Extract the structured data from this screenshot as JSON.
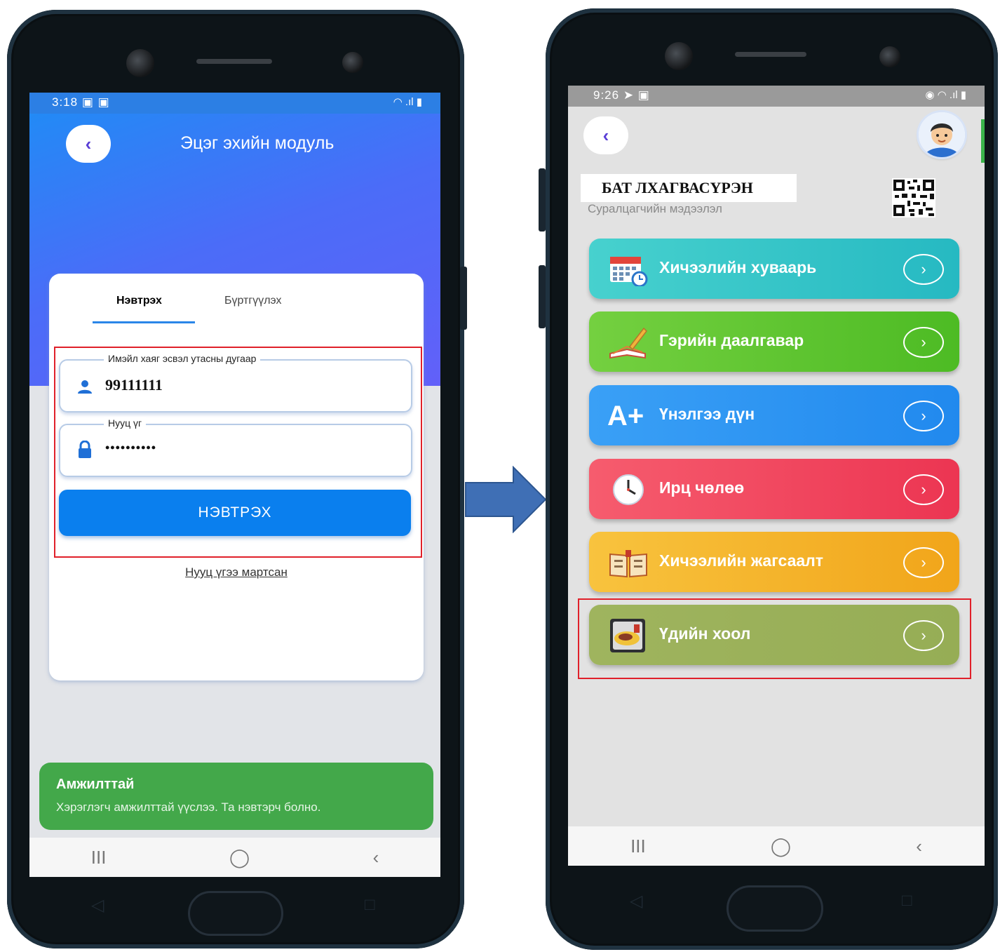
{
  "colors": {
    "accent_blue": "#0a7fee",
    "highlight_red": "#e0202a",
    "success_green": "#43a84a",
    "menu_teal": "#31c4c4",
    "menu_green": "#5ac52c",
    "menu_blue": "#2b8ff3",
    "menu_red": "#f0435f",
    "menu_orange": "#f6b324",
    "menu_olive": "#9db25a"
  },
  "left_screen": {
    "status": {
      "time": "3:18",
      "left_icons": "▣ ▣",
      "right_icons": "◠ .ıl ▮"
    },
    "back_icon": "‹",
    "title": "Эцэг эхийн модуль",
    "tabs": {
      "login": "Нэвтрэх",
      "register": "Бүртгүүлэх"
    },
    "email_field": {
      "label": "Имэйл хаяг эсвэл утасны дугаар",
      "value": "99111111",
      "icon": "user-icon"
    },
    "password_field": {
      "label": "Нууц үг",
      "value": "••••••••••",
      "icon": "lock-icon"
    },
    "login_button": "НЭВТРЭХ",
    "forgot_link": "Нууц үгээ мартсан",
    "toast": {
      "title": "Амжилттай",
      "message": "Хэрэглэгч амжилттай үүслээ. Та нэвтэрч болно."
    },
    "nav": {
      "recent": "III",
      "home": "◯",
      "back": "‹"
    }
  },
  "right_screen": {
    "status": {
      "time": "9:26",
      "left_icons": "➤ ▣",
      "right_icons": "◉ ◠ .ıl ▮"
    },
    "back_icon": "‹",
    "student_name": "БАТ ЛХАГВАСҮРЭН",
    "student_subtitle": "Суралцагчийн мэдээлэл",
    "menu": [
      {
        "label": "Хичээлийн хуваарь",
        "icon": "calendar-icon",
        "arrow": "›"
      },
      {
        "label": "Гэрийн даалгавар",
        "icon": "homework-icon",
        "arrow": "›"
      },
      {
        "label": "Үнэлгээ дүн",
        "icon": "grade-icon",
        "icon_text": "A+",
        "arrow": "›"
      },
      {
        "label": "Ирц чөлөө",
        "icon": "clock-icon",
        "arrow": "›"
      },
      {
        "label": "Хичээлийн жагсаалт",
        "icon": "book-icon",
        "arrow": "›"
      },
      {
        "label": "Үдийн хоол",
        "icon": "lunch-icon",
        "arrow": "›"
      }
    ],
    "nav": {
      "recent": "III",
      "home": "◯",
      "back": "‹"
    }
  }
}
